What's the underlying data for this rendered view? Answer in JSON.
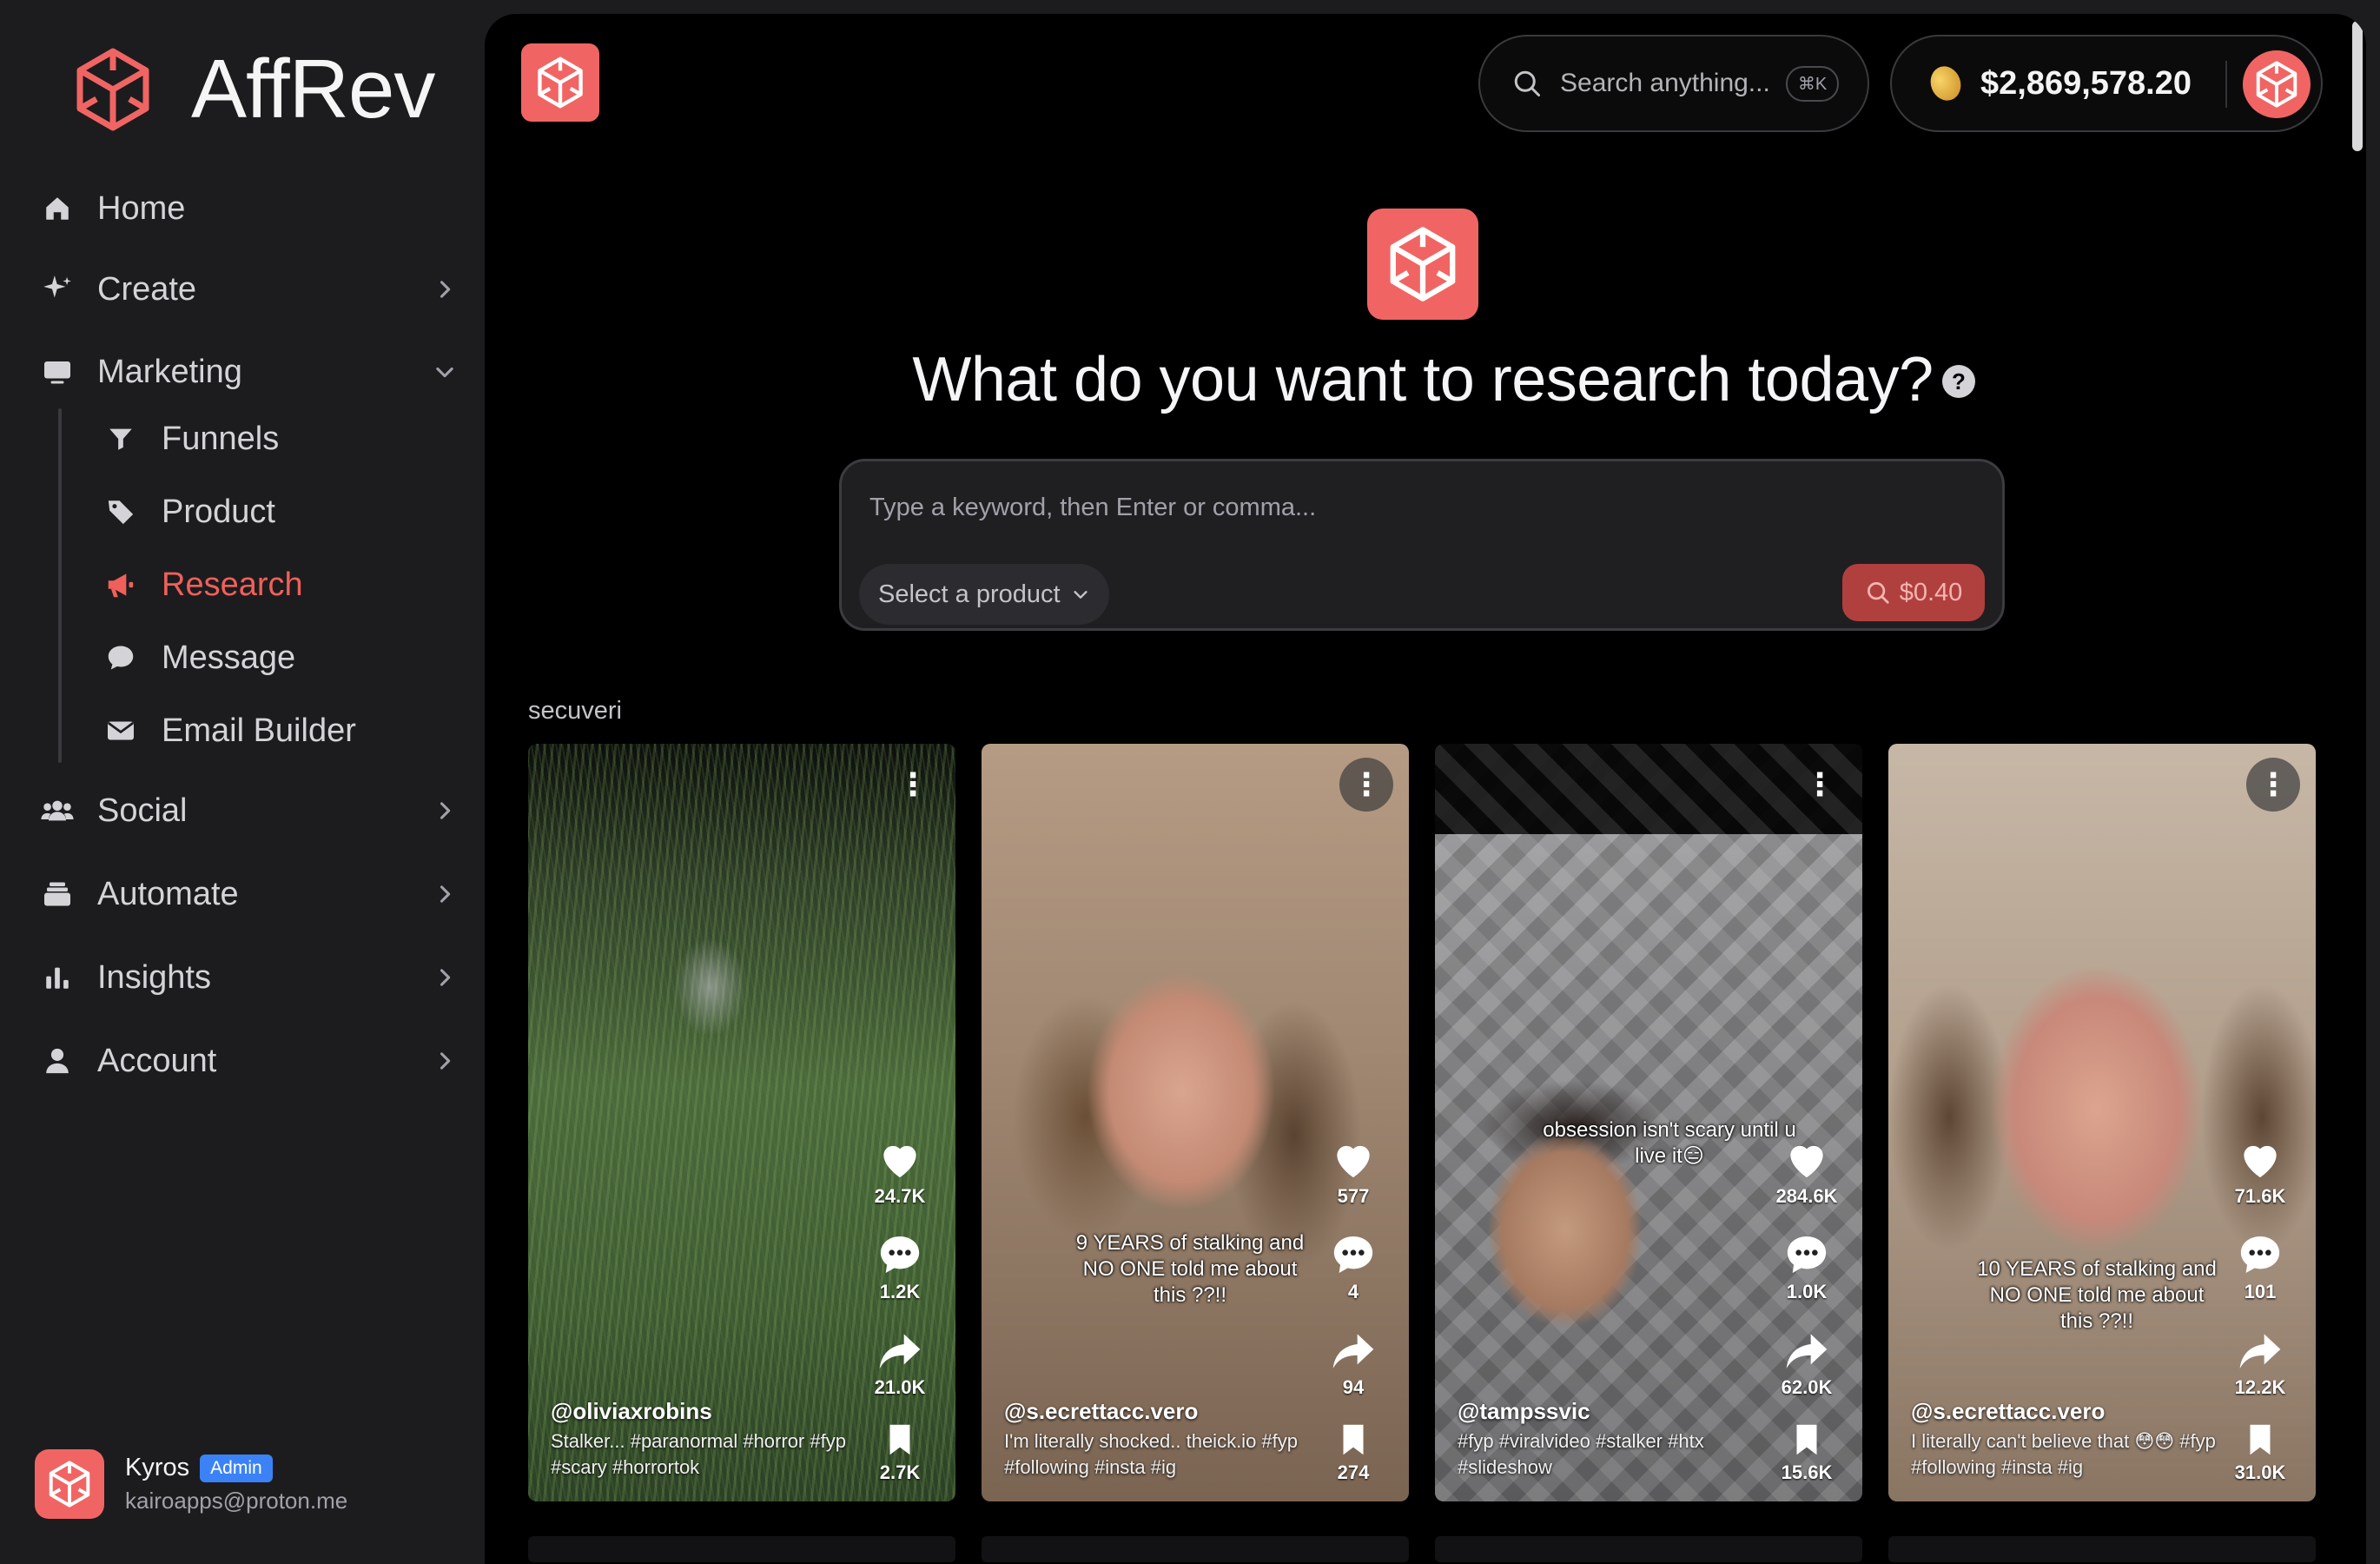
{
  "brand": {
    "name": "AffRev"
  },
  "nav": {
    "home": "Home",
    "create": "Create",
    "marketing": "Marketing",
    "sub": {
      "funnels": "Funnels",
      "product": "Product",
      "research": "Research",
      "message": "Message",
      "email_builder": "Email Builder"
    },
    "social": "Social",
    "automate": "Automate",
    "insights": "Insights",
    "account": "Account",
    "active": "Research"
  },
  "user": {
    "name": "Kyros",
    "role": "Admin",
    "email": "kairoapps@proton.me"
  },
  "header": {
    "search_placeholder": "Search anything...",
    "search_shortcut": "⌘K",
    "balance": "$2,869,578.20"
  },
  "hero": {
    "title": "What do you want to research today?",
    "help": "?"
  },
  "query": {
    "placeholder": "Type a keyword, then Enter or comma...",
    "value": "",
    "product_select": "Select a product",
    "run_label": "$0.40"
  },
  "results": {
    "label": "secuveri",
    "videos": [
      {
        "handle": "@oliviaxrobins",
        "caption": "Stalker... #paranormal #horror #fyp #scary #horrortok",
        "overlay": "",
        "likes": "24.7K",
        "comments": "1.2K",
        "shares": "21.0K",
        "saves": "2.7K"
      },
      {
        "handle": "@s.ecrettacc.vero",
        "caption": "I'm literally shocked.. theick.io #fyp #following #insta #ig",
        "overlay": "9 YEARS of stalking and NO ONE told me about this ??!!",
        "likes": "577",
        "comments": "4",
        "shares": "94",
        "saves": "274"
      },
      {
        "handle": "@tampssvic",
        "caption": "#fyp #viralvideo #stalker #htx #slideshow",
        "overlay": "obsession isn't scary until u live it😑",
        "likes": "284.6K",
        "comments": "1.0K",
        "shares": "62.0K",
        "saves": "15.6K"
      },
      {
        "handle": "@s.ecrettacc.vero",
        "caption": "I literally can't believe that 😳😳 #fyp #following #insta #ig",
        "overlay": "10 YEARS of stalking and NO ONE told me about this ??!!",
        "likes": "71.6K",
        "comments": "101",
        "shares": "12.2K",
        "saves": "31.0K"
      }
    ]
  },
  "colors": {
    "accent": "#f06563",
    "badge": "#3b82f6",
    "panel": "#000000",
    "sidebar": "#1c1c1e"
  }
}
